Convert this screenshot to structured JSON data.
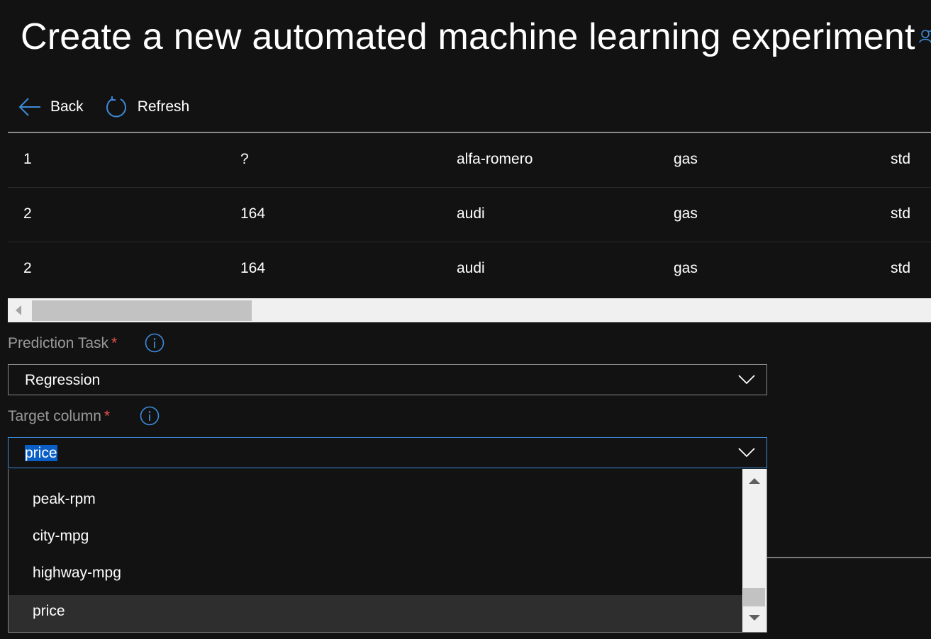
{
  "page": {
    "title": "Create a new automated machine learning experiment"
  },
  "toolbar": {
    "back_label": "Back",
    "refresh_label": "Refresh"
  },
  "preview_table": {
    "rows": [
      [
        "1",
        "?",
        "alfa-romero",
        "gas",
        "std"
      ],
      [
        "2",
        "164",
        "audi",
        "gas",
        "std"
      ],
      [
        "2",
        "164",
        "audi",
        "gas",
        "std"
      ]
    ]
  },
  "prediction_task": {
    "label": "Prediction Task",
    "required_marker": "*",
    "value": "Regression"
  },
  "target_column": {
    "label": "Target column",
    "required_marker": "*",
    "value": "price",
    "options_visible": [
      "peak-rpm",
      "city-mpg",
      "highway-mpg",
      "price"
    ],
    "selected_option": "price"
  },
  "colors": {
    "background": "#121212",
    "accent": "#3c8bd9",
    "selection_highlight": "#0a5fc7",
    "required": "#e3504a",
    "muted_text": "#9a9a9a"
  },
  "icons": {
    "back": "arrow-left-icon",
    "refresh": "refresh-icon",
    "info": "info-icon",
    "dropdown": "chevron-down-icon",
    "corner": "user-icon"
  }
}
